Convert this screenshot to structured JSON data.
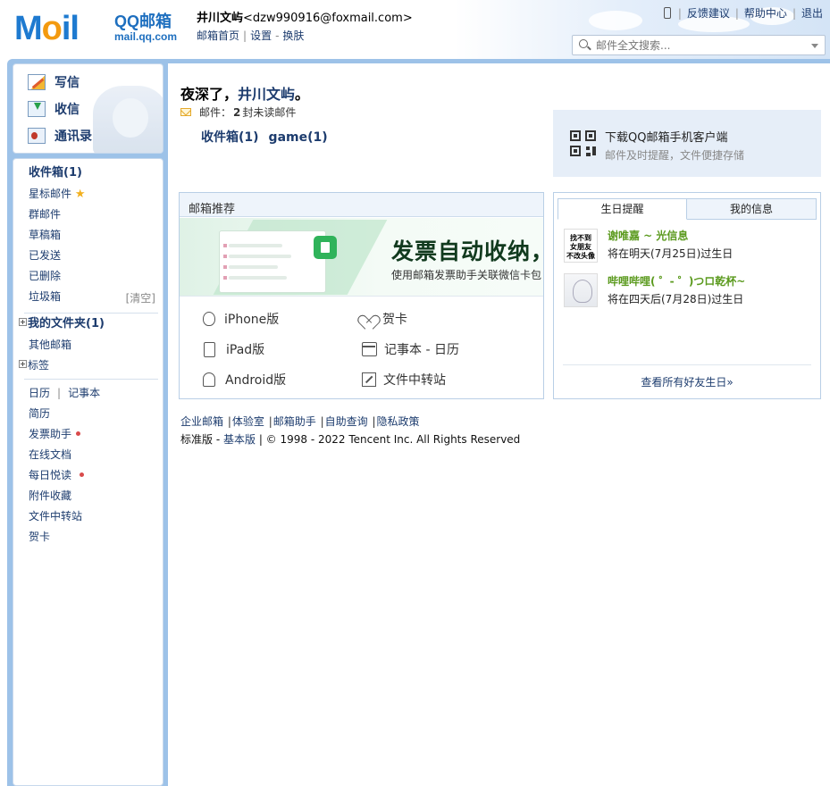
{
  "header": {
    "logo_text": "Mail",
    "logo_brand": "QQ邮箱",
    "logo_url": "mail.qq.com",
    "user_name": "井川文屿",
    "user_email": "<dzw990916@foxmail.com>",
    "links": [
      "邮箱首页",
      "设置",
      "换肤"
    ],
    "top_links": [
      "反馈建议",
      "帮助中心",
      "退出"
    ],
    "search_placeholder": "邮件全文搜索..."
  },
  "sidebar": {
    "actions": [
      "写信",
      "收信",
      "通讯录"
    ],
    "inbox": "收件箱(1)",
    "starred": "星标邮件",
    "group": "群邮件",
    "drafts": "草稿箱",
    "sent": "已发送",
    "deleted": "已删除",
    "spam": "垃圾箱",
    "spam_clear": "[清空]",
    "my_folders": "我的文件夹(1)",
    "other_mail": "其他邮箱",
    "tags": "标签",
    "calendar": "日历",
    "notebook": "记事本",
    "resume": "简历",
    "invoice": "发票助手",
    "docs": "在线文档",
    "daily": "每日悦读",
    "attachments": "附件收藏",
    "transfer": "文件中转站",
    "cards": "贺卡"
  },
  "main": {
    "greeting_prefix": "夜深了，",
    "greeting_name": "井川文屿",
    "greeting_suffix": "。",
    "unread_prefix": "邮件：",
    "unread_count": "2",
    "unread_suffix": "封未读邮件",
    "folders": [
      "收件箱(1)",
      "game(1)"
    ],
    "promo_title": "下载QQ邮箱手机客户端",
    "promo_sub": "邮件及时提醒，文件便捷存储",
    "rec_title": "邮箱推荐",
    "banner_title": "发票自动收纳，",
    "banner_sub": "使用邮箱发票助手关联微信卡包",
    "rec_items": [
      "iPhone版",
      "贺卡",
      "iPad版",
      "记事本 - 日历",
      "Android版",
      "文件中转站"
    ],
    "bday_tabs": [
      "生日提醒",
      "我的信息"
    ],
    "bday": [
      {
        "avatar_text": "找不到\n女朋友\n不改头像",
        "name": "谢唯嘉 ~ 光信息",
        "when": "将在明天(7月25日)过生日"
      },
      {
        "avatar_text": "",
        "name": "哔哩哔哩( ゜- ゜)つロ乾杯~",
        "when": "将在四天后(7月28日)过生日"
      }
    ],
    "bday_all": "查看所有好友生日»"
  },
  "footer": {
    "links": [
      "企业邮箱",
      "体验室",
      "邮箱助手",
      "自助查询",
      "隐私政策"
    ],
    "version_std": "标准版",
    "version_basic": "基本版",
    "copyright": "© 1998 - 2022 Tencent Inc. All Rights Reserved"
  }
}
